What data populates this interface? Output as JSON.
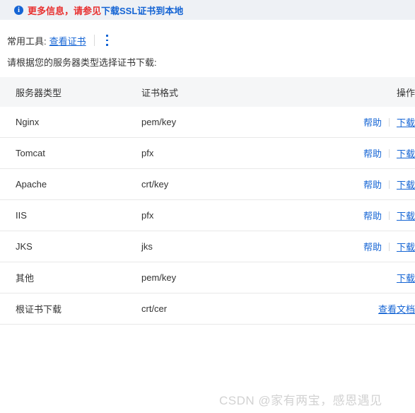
{
  "notice": {
    "icon": "info-circle-icon",
    "text": "更多信息，请参见",
    "link_text": "下载SSL证书到本地",
    "text_color": "#e8302f",
    "link_color": "#1464d4",
    "background": "#eef1f5"
  },
  "tools": {
    "label": "常用工具:",
    "link_text": "查看证书",
    "more_icon": "kebab-menu-icon"
  },
  "instruction": "请根据您的服务器类型选择证书下载:",
  "table": {
    "columns": [
      "服务器类型",
      "证书格式",
      "操作"
    ],
    "header_background": "#f5f6f7",
    "rows": [
      {
        "type": "Nginx",
        "format": "pem/key",
        "help": "帮助",
        "action": "下载"
      },
      {
        "type": "Tomcat",
        "format": "pfx",
        "help": "帮助",
        "action": "下载"
      },
      {
        "type": "Apache",
        "format": "crt/key",
        "help": "帮助",
        "action": "下载"
      },
      {
        "type": "IIS",
        "format": "pfx",
        "help": "帮助",
        "action": "下载"
      },
      {
        "type": "JKS",
        "format": "jks",
        "help": "帮助",
        "action": "下载"
      },
      {
        "type": "其他",
        "format": "pem/key",
        "help": "",
        "action": "下载"
      },
      {
        "type": "根证书下载",
        "format": "crt/cer",
        "help": "",
        "action": "查看文档"
      }
    ]
  },
  "watermark": "CSDN @家有两宝，感恩遇见"
}
